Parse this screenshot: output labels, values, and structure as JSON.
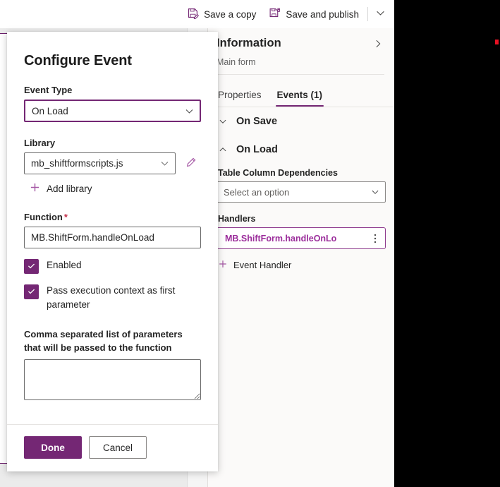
{
  "command_bar": {
    "buttons": [
      {
        "label": "Save a copy",
        "icon": "save-copy-icon"
      },
      {
        "label": "Save and publish",
        "icon": "save-publish-icon"
      }
    ],
    "overflow_icon": "chevron-down-icon"
  },
  "properties_panel": {
    "title": "Information",
    "subtitle": "Main form",
    "collapse_icon": "chevron-right-icon",
    "tabs": [
      {
        "label": "Properties",
        "active": false
      },
      {
        "label": "Events (1)",
        "active": true
      }
    ],
    "sections": [
      {
        "title": "On Save",
        "expanded": false,
        "chevron": "chevron-down-icon"
      },
      {
        "title": "On Load",
        "expanded": true,
        "chevron": "chevron-up-icon",
        "dependencies_label": "Table Column Dependencies",
        "dependencies_value": "Select an option",
        "dependencies_icon": "chevron-down-icon",
        "handlers_label": "Handlers",
        "handlers": [
          {
            "name": "MB.ShiftForm.handleOnLo",
            "more_icon": "more-vertical-icon"
          }
        ],
        "add_handler_label": "Event Handler",
        "add_icon": "plus-icon"
      }
    ]
  },
  "dialog": {
    "title": "Configure Event",
    "event_type": {
      "label": "Event Type",
      "value": "On Load",
      "icon": "chevron-down-icon"
    },
    "library": {
      "label": "Library",
      "value": "mb_shiftformscripts.js",
      "icon": "chevron-down-icon",
      "edit_icon": "pencil-icon",
      "add_label": "Add library",
      "add_icon": "plus-icon"
    },
    "function": {
      "label": "Function",
      "required_mark": "*",
      "value": "MB.ShiftForm.handleOnLoad",
      "placeholder": ""
    },
    "checkboxes": [
      {
        "label": "Enabled",
        "checked": true,
        "icon": "check-icon"
      },
      {
        "label": "Pass execution context as first parameter",
        "checked": true,
        "icon": "check-icon"
      }
    ],
    "parameters": {
      "label": "Comma separated list of parameters that will be passed to the function",
      "value": "",
      "placeholder": ""
    },
    "footer": {
      "primary_label": "Done",
      "secondary_label": "Cancel"
    }
  },
  "colors": {
    "accent_purple": "#742774",
    "chip_purple": "#9b2d9b",
    "required_red": "#c4314b",
    "cursor_red": "#e81123",
    "panel_bg": "#fbfaf9",
    "canvas_bg": "#f5f5f5"
  }
}
